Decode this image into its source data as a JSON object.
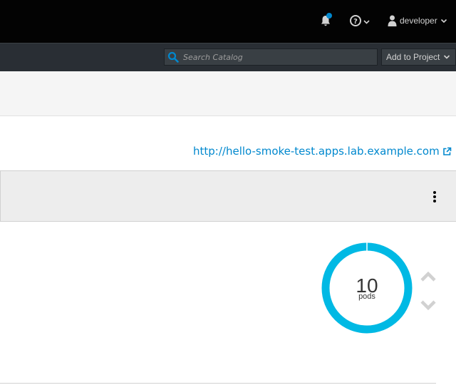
{
  "header": {
    "user": {
      "label": "developer"
    },
    "icons": {
      "notifications": "bell-icon",
      "help": "help-icon",
      "user": "user-icon"
    },
    "colors": {
      "background": "#030303",
      "notification_dot": "#0088ce"
    }
  },
  "toolbar": {
    "search": {
      "placeholder": "Search Catalog",
      "value": ""
    },
    "add_to_project": {
      "label": "Add to Project"
    }
  },
  "route": {
    "url": "http://hello-smoke-test.apps.lab.example.com",
    "icon": "external-link-icon"
  },
  "deployment": {
    "pod_count": "10",
    "pod_unit": "pods",
    "scale_up_icon": "chevron-up-icon",
    "scale_down_icon": "chevron-down-icon",
    "colors": {
      "ring": "#00b9e4"
    }
  }
}
